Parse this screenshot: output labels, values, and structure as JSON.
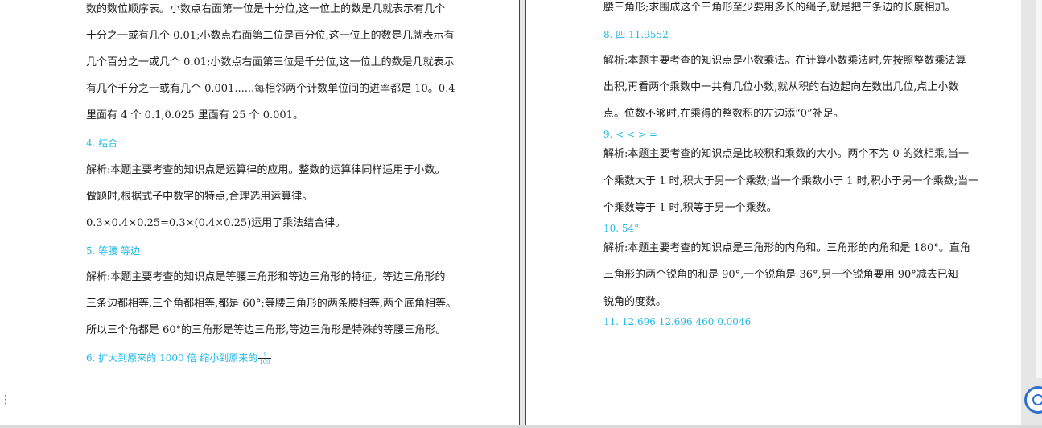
{
  "left_page": {
    "lines": [
      "数的数位顺序表。小数点右面第一位是十分位,这一位上的数是几就表示有几个",
      "十分之一或有几个 0.01;小数点右面第二位是百分位,这一位上的数是几就表示有",
      "几个百分之一或几个 0.01;小数点右面第三位是千分位,这一位上的数是几就表示",
      "有几个千分之一或有几个 0.001......每相邻两个计数单位间的进率都是 10。0.4",
      "里面有 4 个 0.1,0.025 里面有 25 个 0.001。",
      "4. 结合",
      "解析:本题主要考查的知识点是运算律的应用。整数的运算律同样适用于小数。",
      "做题时,根据式子中数字的特点,合理选用运算律。",
      "0.3×0.4×0.25=0.3×(0.4×0.25)运用了乘法结合律。",
      "5. 等腰 等边",
      "解析:本题主要考查的知识点是等腰三角形和等边三角形的特征。等边三角形的",
      "三条边都相等,三个角都相等,都是 60°;等腰三角形的两条腰相等,两个底角相等。",
      "所以三个角都是 60°的三角形是等边三角形,等边三角形是特殊的等腰三角形。",
      "6. 扩大到原来的 1000 倍 缩小到原来的"
    ],
    "fraction": {
      "numerator": "1",
      "denominator": "100"
    }
  },
  "right_page": {
    "lines": [
      "腰三角形;求围成这个三角形至少要用多长的绳子,就是把三条边的长度相加。",
      "8. 四 11.9552",
      "解析:本题主要考查的知识点是小数乘法。在计算小数乘法时,先按照整数乘法算",
      "出积,再看两个乘数中一共有几位小数,就从积的右边起向左数出几位,点上小数",
      "点。位数不够时,在乘得的整数积的左边添“0”补足。",
      "9. < < > =",
      "解析:本题主要考查的知识点是比较积和乘数的大小。两个不为 0 的数相乘,当一",
      "个乘数大于 1 时,积大于另一个乘数;当一个乘数小于 1 时,积小于另一个乘数;当一",
      "个乘数等于 1 时,积等于另一个乘数。",
      "10. 54°",
      "解析:本题主要考查的知识点是三角形的内角和。三角形的内角和是 180°。直角",
      "三角形的两个锐角的和是 90°,一个锐角是 36°,另一个锐角要用 90°减去已知",
      "锐角的度数。",
      "11. 12.696 12.696 460 0.0046"
    ]
  },
  "colors": {
    "answer": "#21b8e6",
    "text": "#222222",
    "background": "#e6e6e6"
  },
  "icons": {
    "floating": "assistant-icon",
    "edge": "expand-handle-icon"
  }
}
